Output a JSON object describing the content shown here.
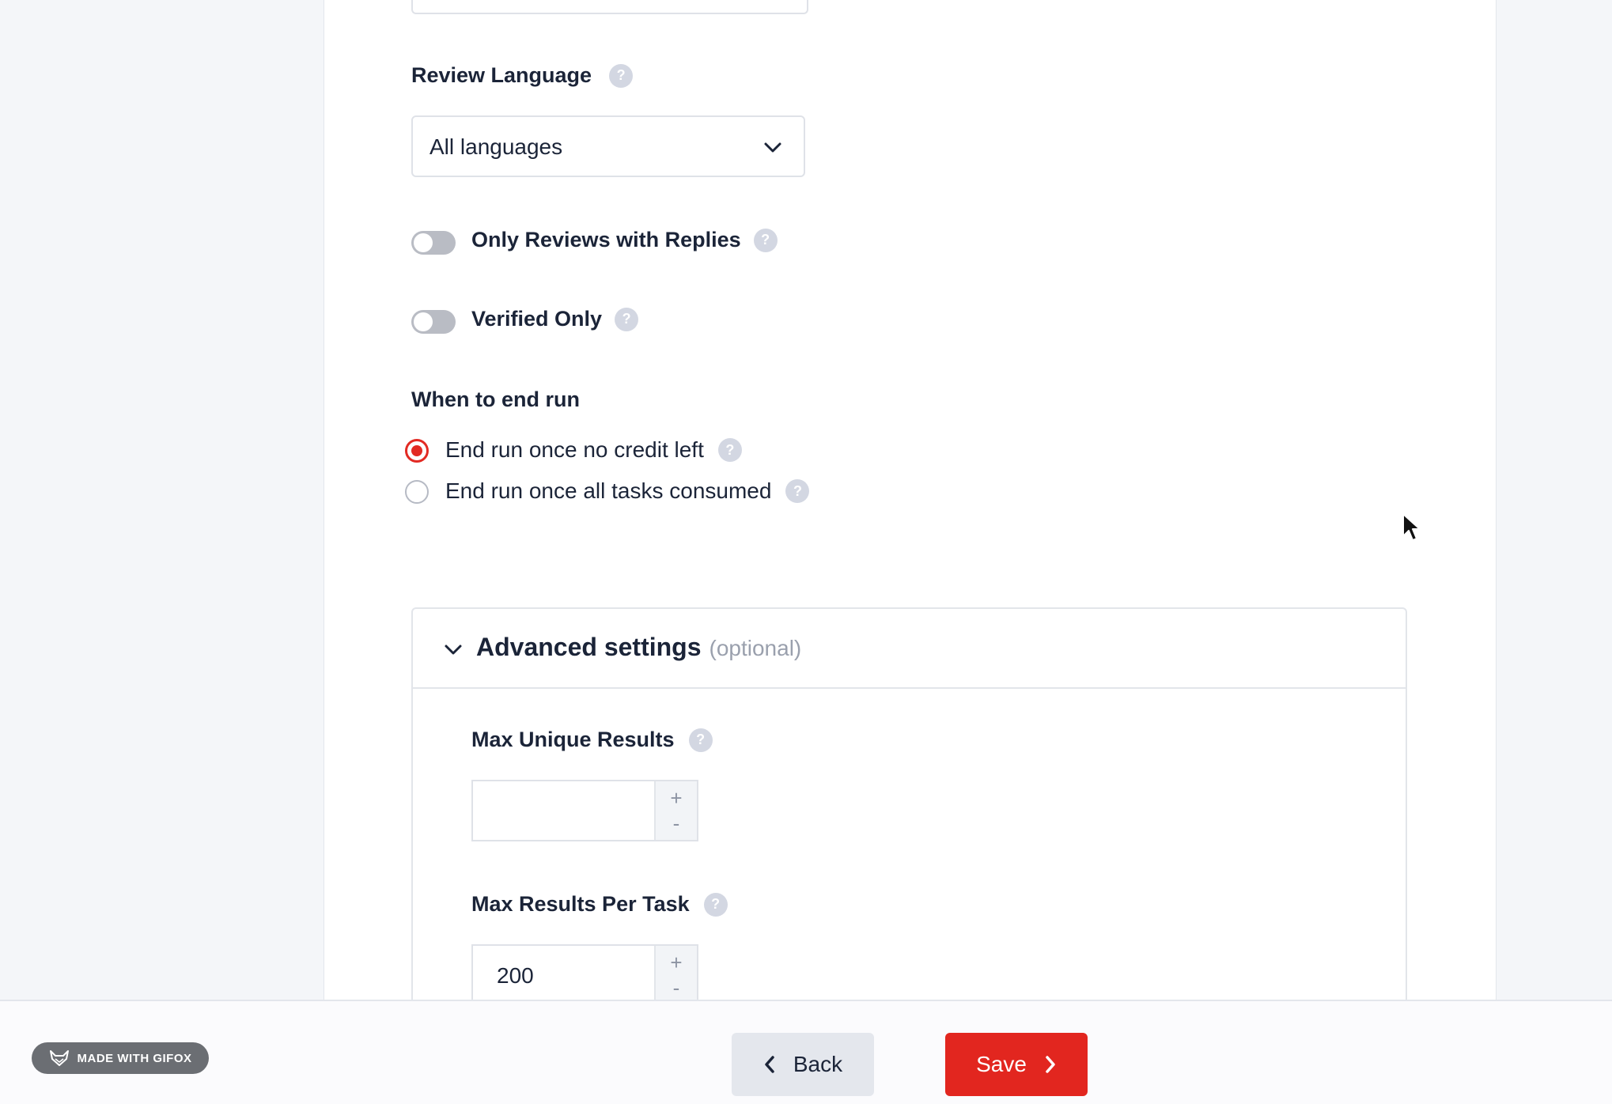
{
  "form": {
    "review_language": {
      "label": "Review Language",
      "help": "?",
      "selected": "All languages"
    },
    "toggles": [
      {
        "label": "Only Reviews with Replies",
        "help": "?",
        "on": false
      },
      {
        "label": "Verified Only",
        "help": "?",
        "on": false
      }
    ],
    "end_run": {
      "label": "When to end run",
      "options": [
        {
          "label": "End run once no credit left",
          "help": "?",
          "checked": true
        },
        {
          "label": "End run once all tasks consumed",
          "help": "?",
          "checked": false
        }
      ]
    }
  },
  "advanced": {
    "title": "Advanced settings",
    "optional": "(optional)",
    "max_unique_results": {
      "label": "Max Unique Results",
      "help": "?",
      "value": ""
    },
    "max_results_per_task": {
      "label": "Max Results Per Task",
      "help": "?",
      "value": "200"
    },
    "stepper_plus": "+",
    "stepper_minus": "-"
  },
  "footer": {
    "back_label": "Back",
    "save_label": "Save",
    "badge_text": "MADE WITH GIFOX"
  },
  "colors": {
    "accent": "#e2261f",
    "help_icon": "#d3d7e2",
    "text": "#1b2438"
  },
  "icons": {
    "dropdown": "chevron-down-icon",
    "back": "chevron-left-icon",
    "save": "chevron-right-icon",
    "collapse": "chevron-down-icon",
    "badge": "fox-icon"
  }
}
